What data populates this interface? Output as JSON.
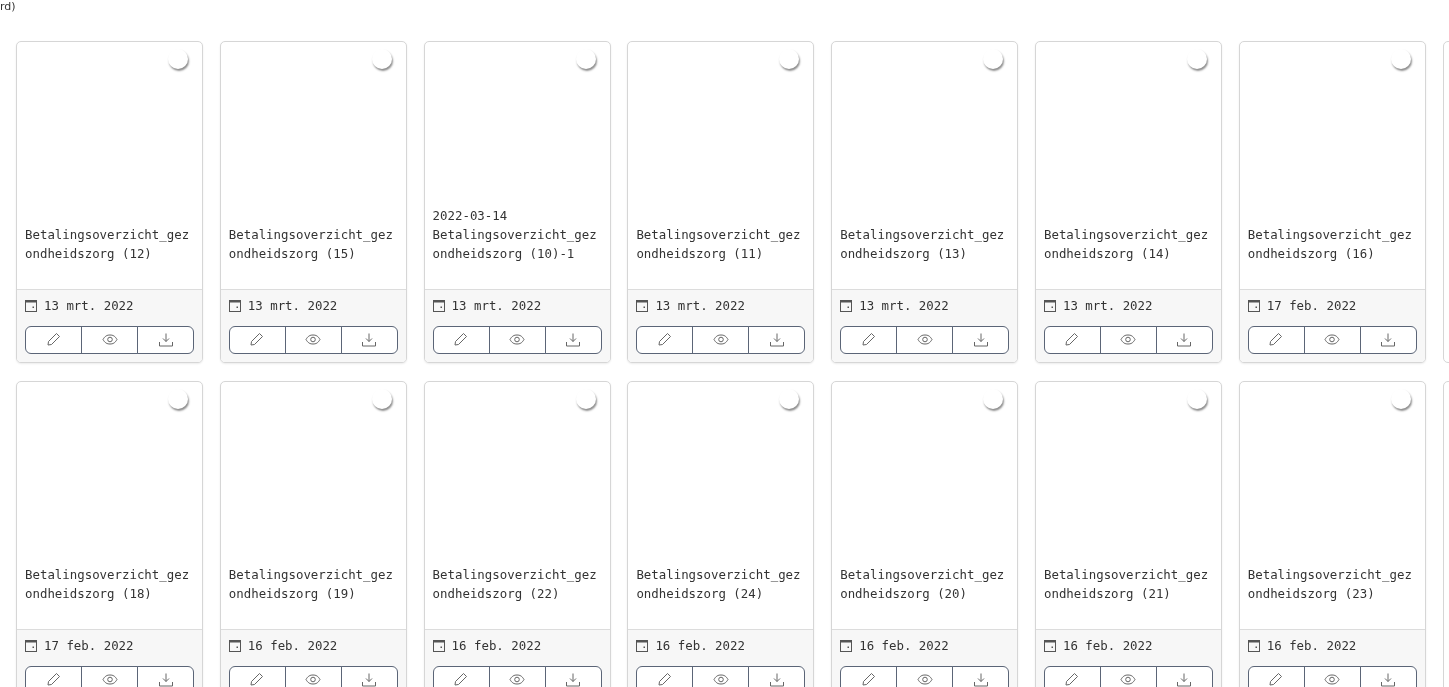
{
  "header_fragment": "rd)",
  "cards": [
    {
      "title": "Betalingsoverzicht_gezondheidszorg (12)",
      "date": "13 mrt. 2022",
      "selected": false
    },
    {
      "title": "Betalingsoverzicht_gezondheidszorg (15)",
      "date": "13 mrt. 2022",
      "selected": false
    },
    {
      "title": "2022-03-14 Betalingsoverzicht_gezondheidszorg (10)-1",
      "date": "13 mrt. 2022",
      "selected": false
    },
    {
      "title": "Betalingsoverzicht_gezondheidszorg (11)",
      "date": "13 mrt. 2022",
      "selected": false
    },
    {
      "title": "Betalingsoverzicht_gezondheidszorg (13)",
      "date": "13 mrt. 2022",
      "selected": false
    },
    {
      "title": "Betalingsoverzicht_gezondheidszorg (14)",
      "date": "13 mrt. 2022",
      "selected": false
    },
    {
      "title": "Betalingsoverzicht_gezondheidszorg (16)",
      "date": "17 feb. 2022",
      "selected": false
    },
    {
      "title": "Betalingsoverzicht_gezondheidszorg (18)",
      "date": "17 feb. 2022",
      "selected": false
    },
    {
      "title": "Betalingsoverzicht_gezondheidszorg (19)",
      "date": "16 feb. 2022",
      "selected": false
    },
    {
      "title": "Betalingsoverzicht_gezondheidszorg (22)",
      "date": "16 feb. 2022",
      "selected": false
    },
    {
      "title": "Betalingsoverzicht_gezondheidszorg (24)",
      "date": "16 feb. 2022",
      "selected": false
    },
    {
      "title": "Betalingsoverzicht_gezondheidszorg (20)",
      "date": "16 feb. 2022",
      "selected": false
    },
    {
      "title": "Betalingsoverzicht_gezondheidszorg (21)",
      "date": "16 feb. 2022",
      "selected": false
    },
    {
      "title": "Betalingsoverzicht_gezondheidszorg (23)",
      "date": "16 feb. 2022",
      "selected": false
    }
  ]
}
